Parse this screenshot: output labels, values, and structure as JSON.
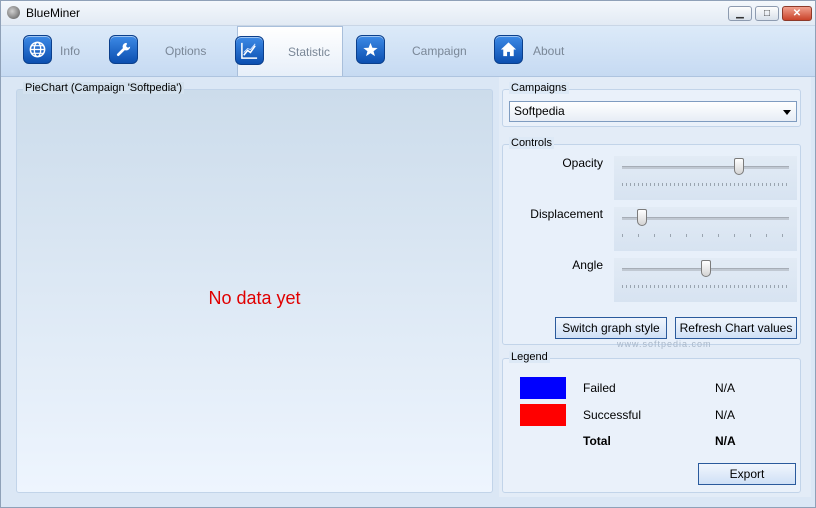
{
  "window": {
    "title": "BlueMiner",
    "min_label": "▁",
    "max_label": "□",
    "close_label": "✕"
  },
  "tabs": [
    {
      "label": "Info",
      "icon": "globe-icon",
      "active": false
    },
    {
      "label": "Options",
      "icon": "wrench-icon",
      "active": false
    },
    {
      "label": "Statistic",
      "icon": "chart-icon",
      "active": true
    },
    {
      "label": "Campaign",
      "icon": "star-icon",
      "active": false
    },
    {
      "label": "About",
      "icon": "home-icon",
      "active": false
    }
  ],
  "piechart": {
    "title": "PieChart (Campaign 'Softpedia')",
    "empty_message": "No data yet"
  },
  "campaigns": {
    "title": "Campaigns",
    "selected": "Softpedia"
  },
  "controls": {
    "title": "Controls",
    "opacity_label": "Opacity",
    "opacity_value": 0.7,
    "displacement_label": "Displacement",
    "displacement_value": 0.12,
    "angle_label": "Angle",
    "angle_value": 0.5,
    "switch_button": "Switch graph style",
    "refresh_button": "Refresh Chart values"
  },
  "legend": {
    "title": "Legend",
    "items": [
      {
        "label": "Failed",
        "value": "N/A",
        "color": "#0000ff"
      },
      {
        "label": "Successful",
        "value": "N/A",
        "color": "#ff0000"
      }
    ],
    "total_label": "Total",
    "total_value": "N/A",
    "export_button": "Export"
  },
  "watermark": "www.softpedia.com",
  "colors": {
    "accent": "#1a66cc",
    "no_data": "#e00000"
  }
}
